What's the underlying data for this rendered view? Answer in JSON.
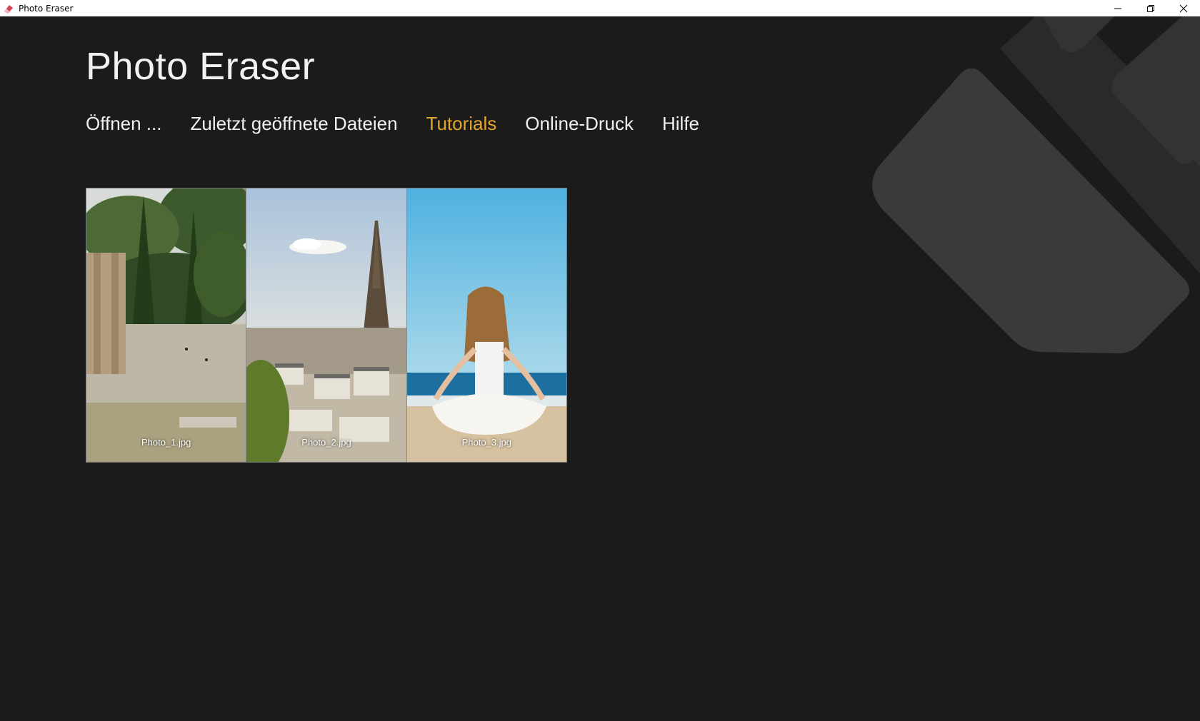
{
  "window": {
    "title": "Photo Eraser",
    "icon": "eraser-app-icon",
    "controls": [
      "minimize-icon",
      "restore-icon",
      "close-icon"
    ]
  },
  "header": {
    "title": "Photo Eraser"
  },
  "nav": {
    "items": [
      {
        "label": "Öffnen ..."
      },
      {
        "label": "Zuletzt geöffnete Dateien"
      },
      {
        "label": "Tutorials",
        "active": true
      },
      {
        "label": "Online-Druck"
      },
      {
        "label": "Hilfe"
      }
    ]
  },
  "gallery": {
    "photos": [
      {
        "filename": "Photo_1.jpg"
      },
      {
        "filename": "Photo_2.jpg"
      },
      {
        "filename": "Photo_3.jpg"
      }
    ]
  },
  "colors": {
    "background": "#1b1b1b",
    "accent": "#e2a52c",
    "text": "#f0f0f0",
    "decoration": "#3a3a3a"
  }
}
